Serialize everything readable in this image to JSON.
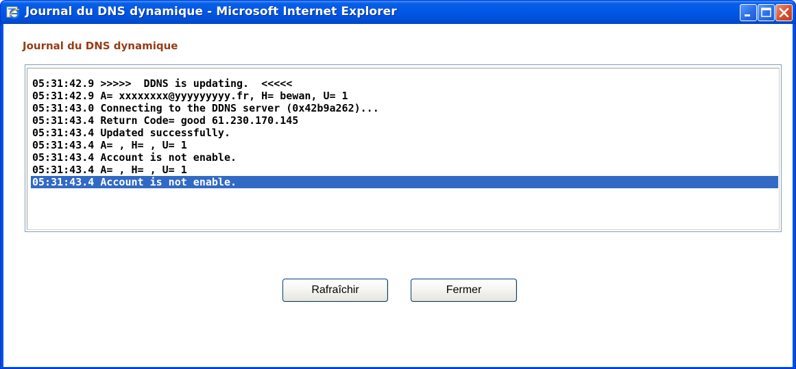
{
  "window": {
    "title": "Journal du DNS dynamique - Microsoft Internet Explorer",
    "icon": "internet-explorer-icon",
    "controls": [
      "minimize-icon",
      "maximize-icon",
      "close-icon"
    ]
  },
  "page": {
    "heading": "Journal du DNS dynamique"
  },
  "log": {
    "lines": [
      "05:31:42.9 >>>>>  DDNS is updating.  <<<<<",
      "05:31:42.9 A= xxxxxxxx@yyyyyyyyy.fr, H= bewan, U= 1",
      "05:31:43.0 Connecting to the DDNS server (0x42b9a262)...",
      "05:31:43.4 Return Code= good 61.230.170.145",
      "05:31:43.4 Updated successfully.",
      "05:31:43.4 A= , H= , U= 1",
      "05:31:43.4 Account is not enable.",
      "05:31:43.4 A= , H= , U= 1",
      "05:31:43.4 Account is not enable."
    ],
    "selected_index": 8
  },
  "buttons": {
    "refresh_label": "Rafraîchir",
    "close_label": "Fermer"
  },
  "colors": {
    "titlebar": "#0058e6",
    "heading": "#963c14",
    "selection": "#316ac5"
  }
}
